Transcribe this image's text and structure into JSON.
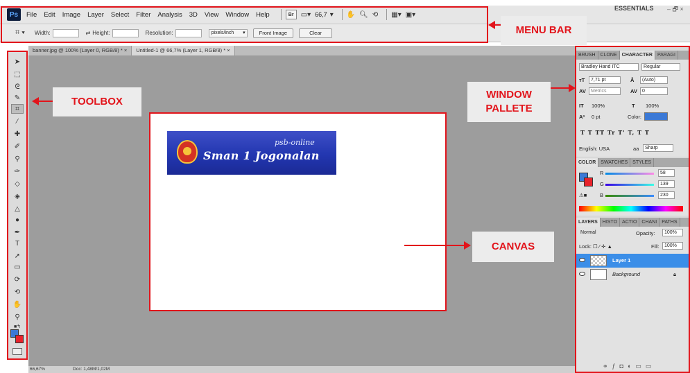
{
  "menubar": {
    "logo": "Ps",
    "items": [
      "File",
      "Edit",
      "Image",
      "Layer",
      "Select",
      "Filter",
      "Analysis",
      "3D",
      "View",
      "Window",
      "Help"
    ],
    "bridge_label": "Br",
    "zoom": "66,7",
    "workspace": "ESSENTIALS",
    "window_controls": "– 🗗 ×"
  },
  "options": {
    "width_label": "Width:",
    "height_label": "Height:",
    "resolution_label": "Resolution:",
    "resolution_unit": "pixels/inch",
    "front_image": "Front Image",
    "clear": "Clear"
  },
  "annotations": {
    "menu_bar": "MENU BAR",
    "toolbox": "TOOLBOX",
    "window_palette_1": "WINDOW",
    "window_palette_2": "PALLETE",
    "canvas": "CANVAS"
  },
  "documents": {
    "tabs": [
      "banner.jpg @ 100% (Layer 0, RGB/8) * ×",
      "Untitled-1 @ 66,7% (Layer 1, RGB/8) * ×"
    ]
  },
  "banner": {
    "subtitle": "psb-online",
    "title": "Sman 1 Jogonalan"
  },
  "statusbar": {
    "zoom": "66,67%",
    "doc": "Doc: 1,48M/1,02M"
  },
  "character_panel": {
    "tabs": [
      "BRUSH",
      "CLONE",
      "CHARACTER",
      "PARAGI"
    ],
    "font_family": "Bradley Hand ITC",
    "font_style": "Regular",
    "font_size": "7,71 pt",
    "leading": "(Auto)",
    "kerning": "Metrics",
    "tracking": "0",
    "vscale": "100%",
    "hscale": "100%",
    "baseline": "0 pt",
    "color_label": "Color:",
    "style_buttons": "T T TT Tr T' T, T T",
    "language": "English: USA",
    "antialias_prefix": "aa",
    "antialias": "Sharp",
    "text_color": "#3b79d6"
  },
  "color_panel": {
    "tabs": [
      "COLOR",
      "SWATCHES",
      "STYLES"
    ],
    "r_label": "R",
    "g_label": "G",
    "b_label": "B",
    "r": "58",
    "g": "139",
    "b": "230"
  },
  "layers_panel": {
    "tabs": [
      "LAYERS",
      "HISTO",
      "ACTIO",
      "CHANI",
      "PATHS"
    ],
    "blend_mode": "Normal",
    "opacity_label": "Opacity:",
    "opacity": "100%",
    "lock_label": "Lock:",
    "fill_label": "Fill:",
    "fill": "100%",
    "layers": [
      {
        "name": "Layer 1",
        "selected": true
      },
      {
        "name": "Background",
        "selected": false
      }
    ]
  },
  "colors": {
    "annotation_red": "#e2141b",
    "foreground": "#3b79d6",
    "background": "#e8232b",
    "selected_layer": "#3b8ee8"
  }
}
